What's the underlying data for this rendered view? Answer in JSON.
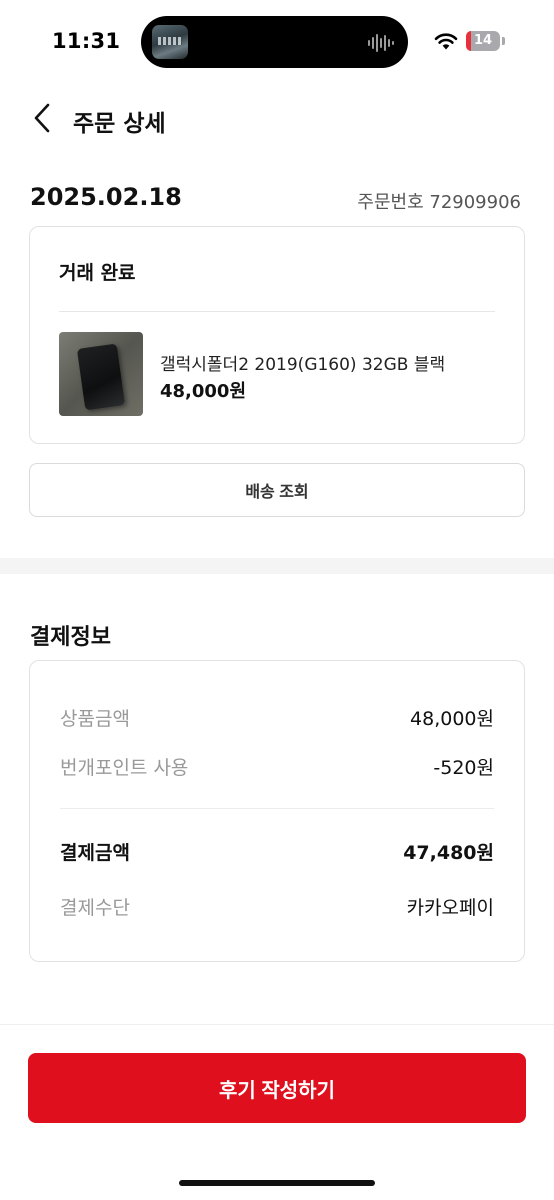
{
  "status_bar": {
    "time": "11:31",
    "battery_level": "14",
    "battery_fraction": 0.14,
    "battery_color": "#e8303a"
  },
  "header": {
    "title": "주문 상세",
    "back_icon": "chevron-left-icon"
  },
  "order": {
    "date": "2025.02.18",
    "number_label": "주문번호 72909906",
    "status": "거래 완료",
    "product": {
      "name": "갤럭시폴더2 2019(G160) 32GB 블랙",
      "price": "48,000원"
    },
    "delivery_button": "배송 조회"
  },
  "payment": {
    "title": "결제정보",
    "rows": [
      {
        "label": "상품금액",
        "value": "48,000원"
      },
      {
        "label": "번개포인트 사용",
        "value": "-520원"
      }
    ],
    "total": {
      "label": "결제금액",
      "value": "47,480원"
    },
    "method": {
      "label": "결제수단",
      "value": "카카오페이"
    }
  },
  "cta": {
    "label": "후기 작성하기",
    "color": "#df0f1d"
  }
}
